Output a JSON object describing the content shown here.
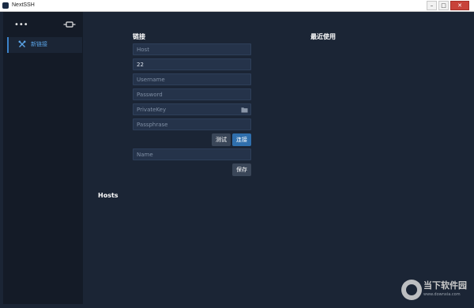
{
  "window": {
    "title": "NextSSH",
    "controls": [
      "–",
      "□",
      "✕"
    ]
  },
  "sidebar": {
    "more_label": "•••",
    "items": [
      {
        "label": "新链接",
        "icon": "tools-icon"
      }
    ]
  },
  "connection": {
    "title": "链接",
    "host": {
      "placeholder": "Host",
      "value": ""
    },
    "port": {
      "placeholder": "",
      "value": "22"
    },
    "username": {
      "placeholder": "Username",
      "value": ""
    },
    "password": {
      "placeholder": "Password",
      "value": ""
    },
    "private_key": {
      "placeholder": "PrivateKey",
      "value": ""
    },
    "passphrase": {
      "placeholder": "Passphrase",
      "value": ""
    },
    "test_label": "测试",
    "connect_label": "连接",
    "name": {
      "placeholder": "Name",
      "value": ""
    },
    "save_label": "保存"
  },
  "recent": {
    "title": "最近使用"
  },
  "hosts": {
    "title": "Hosts"
  },
  "watermark": {
    "text": "当下软件园",
    "url": "www.downxia.com"
  },
  "colors": {
    "background": "#1b2535",
    "sidebar": "#141b27",
    "accent": "#3b82c9",
    "primary_button": "#2f6fad",
    "secondary_button": "#3a4658",
    "field": "#25334a"
  }
}
